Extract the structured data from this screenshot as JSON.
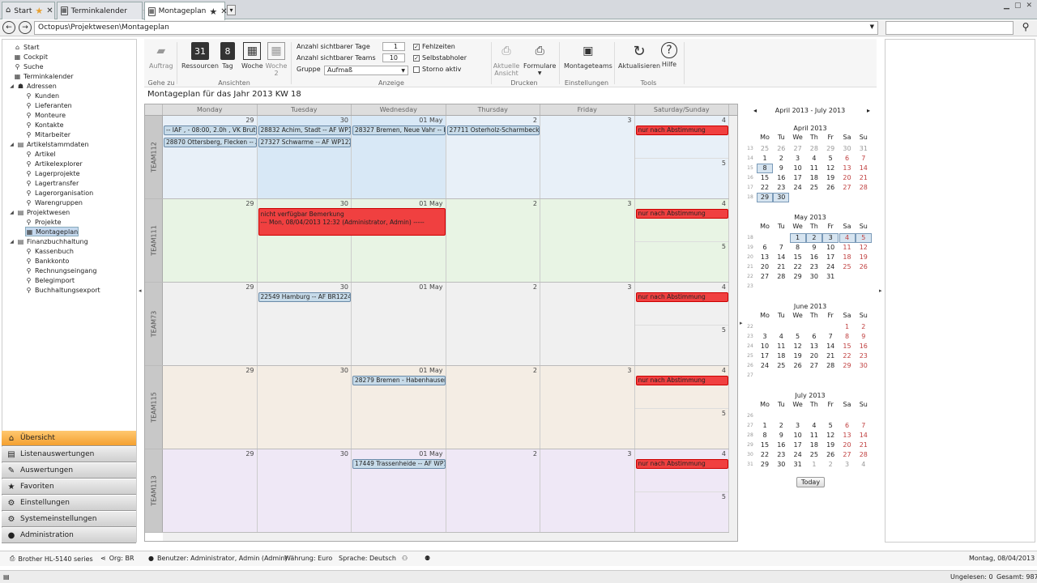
{
  "tabs": [
    {
      "label": "Start",
      "star": "orange"
    },
    {
      "label": "Terminkalender",
      "star": "grey"
    },
    {
      "label": "Montageplan",
      "star": "dark"
    }
  ],
  "address": "Octopus\\Projektwesen\\Montageplan",
  "tree": [
    {
      "label": "Start",
      "level": 1
    },
    {
      "label": "Cockpit",
      "level": 1
    },
    {
      "label": "Suche",
      "level": 1
    },
    {
      "label": "Terminkalender",
      "level": 1
    },
    {
      "label": "Adressen",
      "level": 0
    },
    {
      "label": "Kunden",
      "level": 2
    },
    {
      "label": "Lieferanten",
      "level": 2
    },
    {
      "label": "Monteure",
      "level": 2
    },
    {
      "label": "Kontakte",
      "level": 2
    },
    {
      "label": "Mitarbeiter",
      "level": 2
    },
    {
      "label": "Artikelstammdaten",
      "level": 0
    },
    {
      "label": "Artikel",
      "level": 2
    },
    {
      "label": "Artikelexplorer",
      "level": 2
    },
    {
      "label": "Lagerprojekte",
      "level": 2
    },
    {
      "label": "Lagertransfer",
      "level": 2
    },
    {
      "label": "Lagerorganisation",
      "level": 2
    },
    {
      "label": "Warengruppen",
      "level": 2
    },
    {
      "label": "Projektwesen",
      "level": 0
    },
    {
      "label": "Projekte",
      "level": 2
    },
    {
      "label": "Montageplan",
      "level": 2
    },
    {
      "label": "Finanzbuchhaltung",
      "level": 0
    },
    {
      "label": "Kassenbuch",
      "level": 2
    },
    {
      "label": "Bankkonto",
      "level": 2
    },
    {
      "label": "Rechnungseingang",
      "level": 2
    },
    {
      "label": "Belegimport",
      "level": 2
    },
    {
      "label": "Buchhaltungsexport",
      "level": 2
    }
  ],
  "navgroups": [
    "Übersicht",
    "Listenauswertungen",
    "Auswertungen",
    "Favoriten",
    "Einstellungen",
    "Systemeinstellungen",
    "Administration"
  ],
  "ribbon": {
    "auftrag": "Auftrag",
    "goto": "Gehe zu",
    "ressourcen": "Ressourcen",
    "tag": "Tag",
    "woche": "Woche",
    "woche2": "Woche 2",
    "ansichten": "Ansichten",
    "tag_icon": "31",
    "woche_icon": "8",
    "lbl_tage": "Anzahl sichtbarer Tage",
    "lbl_teams": "Anzahl sichtbarer Teams",
    "lbl_gruppe": "Gruppe",
    "val_tage": "1",
    "val_teams": "10",
    "val_gruppe": "Aufmaß",
    "anzeige": "Anzeige",
    "chk_fehlzeiten": "Fehlzeiten",
    "chk_selbstabholer": "Selbstabholer",
    "chk_storno": "Storno aktiv",
    "aktuelle": "Aktuelle Ansicht",
    "formulare": "Formulare",
    "drucken": "Drucken",
    "montageteams": "Montageteams",
    "einstellungen": "Einstellungen",
    "aktualisieren": "Aktualisieren",
    "hilfe": "Hilfe",
    "tools": "Tools"
  },
  "plan_title": "Montageplan für das Jahr 2013 KW 18",
  "days": [
    "Monday",
    "Tuesday",
    "Wednesday",
    "Thursday",
    "Friday",
    "Saturday/Sunday"
  ],
  "teams": [
    {
      "label": "TEAM112",
      "color": "#ffffff",
      "dates": [
        "29",
        "30",
        "01 May",
        "2",
        "3",
        "4",
        "5"
      ],
      "events": [
        {
          "text": "-- IAF , - 08:00, 2.0h , VK Brut",
          "col": 0,
          "row": 0,
          "span": 1
        },
        {
          "text": "28832 Achim, Stadt -- AF WP12",
          "col": 1,
          "row": 0,
          "span": 1
        },
        {
          "text": "28327 Bremen, Neue Vahr -- IA",
          "col": 2,
          "row": 0,
          "span": 1
        },
        {
          "text": "27711 Osterholz-Scharmbeck, S",
          "col": 3,
          "row": 0,
          "span": 1
        },
        {
          "text": "28870 Ottersberg, Flecken -- Al",
          "col": 0,
          "row": 1,
          "span": 1
        },
        {
          "text": "27327 Schwarme -- AF WP1225",
          "col": 1,
          "row": 1,
          "span": 1
        },
        {
          "text": "nur nach Abstimmung",
          "col": 5,
          "row": 0,
          "span": 1,
          "red": true
        }
      ]
    },
    {
      "label": "TEAM111",
      "color": "#ffffff",
      "dates": [
        "29",
        "30",
        "01 May",
        "2",
        "3",
        "4",
        "5"
      ],
      "events": [
        {
          "text": "nicht verfügbar Bemerkung\n--- Mon, 08/04/2013 12:32 (Administrator, Admin) -----",
          "col": 1,
          "row": 0,
          "span": 2,
          "red": true,
          "big": true
        },
        {
          "text": "nur nach Abstimmung",
          "col": 5,
          "row": 0,
          "span": 1,
          "red": true
        }
      ]
    },
    {
      "label": "TEAM73",
      "color": "#ffffff",
      "dates": [
        "29",
        "30",
        "01 May",
        "2",
        "3",
        "4",
        "5"
      ],
      "events": [
        {
          "text": "22549 Hamburg -- AF BR12245",
          "col": 1,
          "row": 0,
          "span": 1
        },
        {
          "text": "nur nach Abstimmung",
          "col": 5,
          "row": 0,
          "span": 1,
          "red": true
        }
      ]
    },
    {
      "label": "TEAM115",
      "color": "#ffffff",
      "dates": [
        "29",
        "30",
        "01 May",
        "2",
        "3",
        "4",
        "5"
      ],
      "events": [
        {
          "text": "28279 Bremen - Habenhausen",
          "col": 2,
          "row": 0,
          "span": 1
        },
        {
          "text": "nur nach Abstimmung",
          "col": 5,
          "row": 0,
          "span": 1,
          "red": true
        }
      ]
    },
    {
      "label": "TEAM113",
      "color": "#ffffff",
      "dates": [
        "29",
        "30",
        "01 May",
        "2",
        "3",
        "4",
        "5"
      ],
      "events": [
        {
          "text": "17449 Trassenheide -- AF WP1.",
          "col": 2,
          "row": 0,
          "span": 1
        },
        {
          "text": "nur nach Abstimmung",
          "col": 5,
          "row": 0,
          "span": 1,
          "red": true
        }
      ]
    }
  ],
  "team_colors": [
    "#e8f0f8",
    "#e8f4e4",
    "#f0f0f0",
    "#f4ede4",
    "#efe8f6"
  ],
  "mini": {
    "range": "April 2013 - July 2013",
    "weekdays": [
      "Mo",
      "Tu",
      "We",
      "Th",
      "Fr",
      "Sa",
      "Su"
    ],
    "today": "Today",
    "months": [
      {
        "title": "April 2013",
        "weeks": [
          {
            "wk": "13",
            "days": [
              "25",
              "26",
              "27",
              "28",
              "29",
              "30",
              "31"
            ],
            "grey": [
              0,
              1,
              2,
              3,
              4,
              5,
              6
            ]
          },
          {
            "wk": "14",
            "days": [
              "1",
              "2",
              "3",
              "4",
              "5",
              "6",
              "7"
            ]
          },
          {
            "wk": "15",
            "days": [
              "8",
              "9",
              "10",
              "11",
              "12",
              "13",
              "14"
            ],
            "hl": [
              0
            ]
          },
          {
            "wk": "16",
            "days": [
              "15",
              "16",
              "17",
              "18",
              "19",
              "20",
              "21"
            ]
          },
          {
            "wk": "17",
            "days": [
              "22",
              "23",
              "24",
              "25",
              "26",
              "27",
              "28"
            ]
          },
          {
            "wk": "18",
            "days": [
              "29",
              "30",
              "",
              "",
              "",
              "",
              ""
            ],
            "hl": [
              0,
              1
            ]
          }
        ]
      },
      {
        "title": "May 2013",
        "weeks": [
          {
            "wk": "18",
            "days": [
              "",
              "",
              "1",
              "2",
              "3",
              "4",
              "5"
            ],
            "hl": [
              2,
              3,
              4,
              5,
              6
            ]
          },
          {
            "wk": "19",
            "days": [
              "6",
              "7",
              "8",
              "9",
              "10",
              "11",
              "12"
            ]
          },
          {
            "wk": "20",
            "days": [
              "13",
              "14",
              "15",
              "16",
              "17",
              "18",
              "19"
            ]
          },
          {
            "wk": "21",
            "days": [
              "20",
              "21",
              "22",
              "23",
              "24",
              "25",
              "26"
            ]
          },
          {
            "wk": "22",
            "days": [
              "27",
              "28",
              "29",
              "30",
              "31",
              "",
              ""
            ]
          },
          {
            "wk": "23",
            "days": [
              "",
              "",
              "",
              "",
              "",
              "",
              ""
            ]
          }
        ]
      },
      {
        "title": "June 2013",
        "weeks": [
          {
            "wk": "22",
            "days": [
              "",
              "",
              "",
              "",
              "",
              "1",
              "2"
            ]
          },
          {
            "wk": "23",
            "days": [
              "3",
              "4",
              "5",
              "6",
              "7",
              "8",
              "9"
            ]
          },
          {
            "wk": "24",
            "days": [
              "10",
              "11",
              "12",
              "13",
              "14",
              "15",
              "16"
            ]
          },
          {
            "wk": "25",
            "days": [
              "17",
              "18",
              "19",
              "20",
              "21",
              "22",
              "23"
            ]
          },
          {
            "wk": "26",
            "days": [
              "24",
              "25",
              "26",
              "27",
              "28",
              "29",
              "30"
            ]
          },
          {
            "wk": "27",
            "days": [
              "",
              "",
              "",
              "",
              "",
              "",
              ""
            ]
          }
        ]
      },
      {
        "title": "July 2013",
        "weeks": [
          {
            "wk": "26",
            "days": [
              "",
              "",
              "",
              "",
              "",
              "",
              ""
            ]
          },
          {
            "wk": "27",
            "days": [
              "1",
              "2",
              "3",
              "4",
              "5",
              "6",
              "7"
            ]
          },
          {
            "wk": "28",
            "days": [
              "8",
              "9",
              "10",
              "11",
              "12",
              "13",
              "14"
            ]
          },
          {
            "wk": "29",
            "days": [
              "15",
              "16",
              "17",
              "18",
              "19",
              "20",
              "21"
            ]
          },
          {
            "wk": "30",
            "days": [
              "22",
              "23",
              "24",
              "25",
              "26",
              "27",
              "28"
            ]
          },
          {
            "wk": "31",
            "days": [
              "29",
              "30",
              "31",
              "1",
              "2",
              "3",
              "4"
            ],
            "grey": [
              3,
              4,
              5,
              6
            ]
          }
        ]
      }
    ]
  },
  "status": {
    "printer": "Brother HL-5140 series",
    "org": "Org: BR",
    "user": "Benutzer: Administrator, Admin (Admin)",
    "currency": "Währung: Euro",
    "language": "Sprache: Deutsch",
    "date": "Montag, 08/04/2013",
    "unread": "Ungelesen: 0",
    "total": "Gesamt: 987"
  }
}
